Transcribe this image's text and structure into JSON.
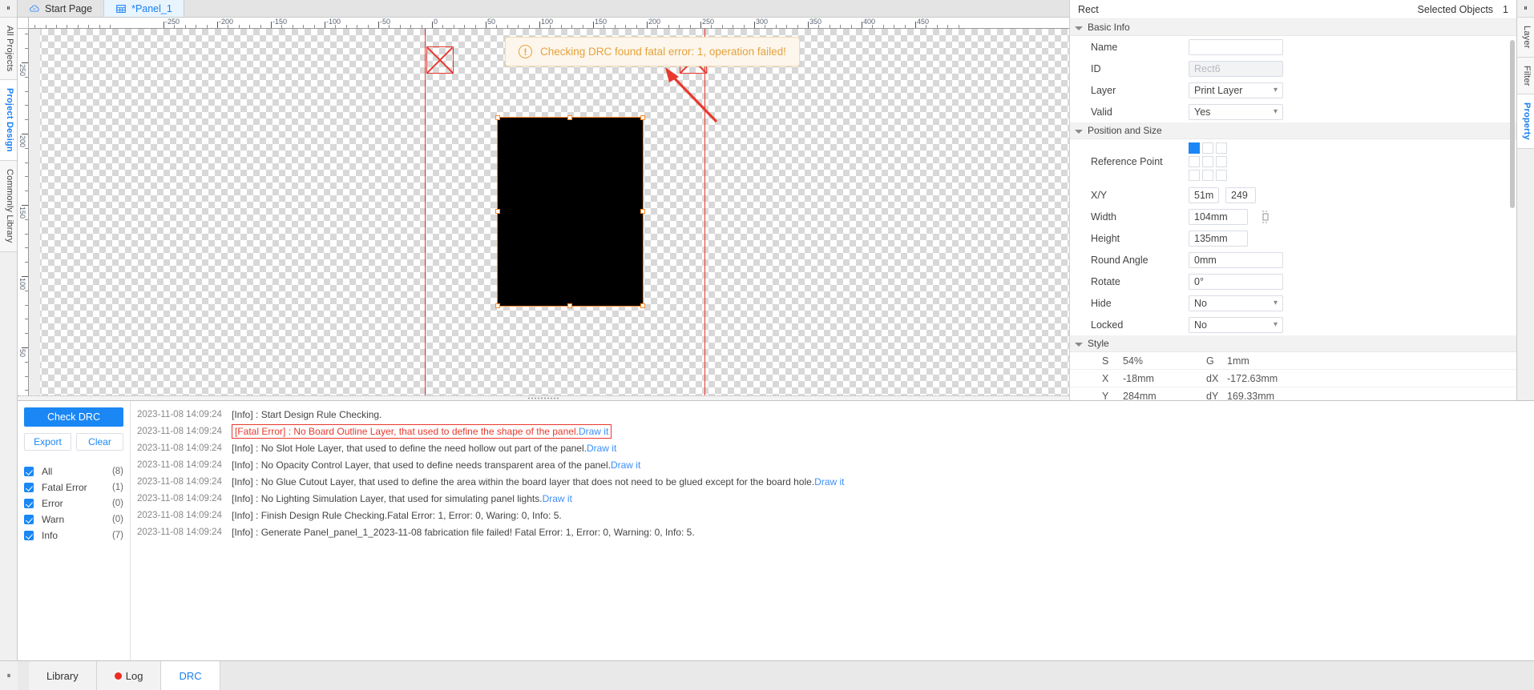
{
  "left_rail": {
    "pin_icon": "pin-icon",
    "tabs": [
      {
        "label": "All Projects",
        "active": false
      },
      {
        "label": "Project Design",
        "active": true
      },
      {
        "label": "Commonly Library",
        "active": false
      }
    ]
  },
  "right_rail": {
    "pin_icon": "pin-icon",
    "tabs": [
      {
        "label": "Layer",
        "active": false
      },
      {
        "label": "Filter",
        "active": false
      },
      {
        "label": "Property",
        "active": true
      }
    ]
  },
  "doc_tabs": [
    {
      "label": "Start Page",
      "icon": "cloud-icon",
      "active": false
    },
    {
      "label": "*Panel_1",
      "icon": "panel-grid-icon",
      "active": true
    }
  ],
  "canvas": {
    "h_ruler_labels": [
      "-250",
      "-200",
      "-150",
      "-100",
      "-50",
      "0",
      "50",
      "100",
      "150",
      "200",
      "250",
      "300",
      "350",
      "400",
      "450"
    ],
    "v_ruler_labels": [
      "250",
      "200",
      "150",
      "100",
      "50"
    ],
    "toast": {
      "icon": "warning-circle-icon",
      "message": "Checking DRC found fatal error: 1, operation failed!"
    }
  },
  "properties": {
    "header": {
      "object_type": "Rect",
      "selected_label": "Selected Objects",
      "selected_count": "1"
    },
    "basic_info": {
      "title": "Basic Info",
      "name_label": "Name",
      "name_value": "",
      "id_label": "ID",
      "id_value": "Rect6",
      "layer_label": "Layer",
      "layer_value": "Print Layer",
      "valid_label": "Valid",
      "valid_value": "Yes"
    },
    "position_size": {
      "title": "Position and Size",
      "reference_point_label": "Reference Point",
      "xy_label": "X/Y",
      "x_value": "51m",
      "y_value": "249",
      "width_label": "Width",
      "width_value": "104mm",
      "height_label": "Height",
      "height_value": "135mm",
      "round_angle_label": "Round Angle",
      "round_angle_value": "0mm",
      "rotate_label": "Rotate",
      "rotate_value": "0°",
      "hide_label": "Hide",
      "hide_value": "No",
      "locked_label": "Locked",
      "locked_value": "No",
      "lock_ratio_icon": "lock-aspect-ratio-icon"
    },
    "style": {
      "title": "Style",
      "rows": [
        {
          "k1": "S",
          "v1": "54%",
          "k2": "G",
          "v2": "1mm"
        },
        {
          "k1": "X",
          "v1": "-18mm",
          "k2": "dX",
          "v2": "-172.63mm"
        },
        {
          "k1": "Y",
          "v1": "284mm",
          "k2": "dY",
          "v2": "169.33mm"
        }
      ]
    }
  },
  "drc": {
    "check_button": "Check DRC",
    "export_button": "Export",
    "clear_button": "Clear",
    "filters": [
      {
        "label": "All",
        "count": "(8)",
        "checked": true
      },
      {
        "label": "Fatal Error",
        "count": "(1)",
        "checked": true
      },
      {
        "label": "Error",
        "count": "(0)",
        "checked": true
      },
      {
        "label": "Warn",
        "count": "(0)",
        "checked": true
      },
      {
        "label": "Info",
        "count": "(7)",
        "checked": true
      }
    ],
    "log": [
      {
        "time": "2023-11-08 14:09:24",
        "level": "[Info]",
        "message": " : Start Design Rule Checking.",
        "link": "",
        "severity": "info"
      },
      {
        "time": "2023-11-08 14:09:24",
        "level": "[Fatal Error]",
        "message": " : No Board Outline Layer, that used to define the shape of the panel.",
        "link": "Draw it",
        "severity": "fatal"
      },
      {
        "time": "2023-11-08 14:09:24",
        "level": "[Info]",
        "message": " : No Slot Hole Layer, that used to define the need hollow out part of the panel.",
        "link": "Draw it",
        "severity": "info"
      },
      {
        "time": "2023-11-08 14:09:24",
        "level": "[Info]",
        "message": " : No Opacity Control Layer, that used to define needs transparent area of the panel.",
        "link": "Draw it",
        "severity": "info"
      },
      {
        "time": "2023-11-08 14:09:24",
        "level": "[Info]",
        "message": " : No Glue Cutout Layer, that used to define the area within the board layer that does not need to be glued except for the board hole.",
        "link": "Draw it",
        "severity": "info"
      },
      {
        "time": "2023-11-08 14:09:24",
        "level": "[Info]",
        "message": " : No Lighting Simulation Layer, that used for simulating panel lights.",
        "link": "Draw it",
        "severity": "info"
      },
      {
        "time": "2023-11-08 14:09:24",
        "level": "[Info]",
        "message": " : Finish Design Rule Checking.Fatal Error: 1, Error: 0, Waring: 0, Info: 5.",
        "link": "",
        "severity": "info"
      },
      {
        "time": "2023-11-08 14:09:24",
        "level": "[Info]",
        "message": " : Generate Panel_panel_1_2023-11-08 fabrication file failed! Fatal Error: 1, Error: 0, Warning: 0, Info: 5.",
        "link": "",
        "severity": "info"
      }
    ]
  },
  "bottom_tabs": [
    {
      "label": "Library",
      "active": false,
      "icon": ""
    },
    {
      "label": "Log",
      "active": false,
      "icon": "red-dot-icon"
    },
    {
      "label": "DRC",
      "active": true,
      "icon": ""
    }
  ],
  "colors": {
    "accent": "#1a87f5",
    "error": "#e8392e",
    "warn": "#e6a23c",
    "selection": "#ff8c2b"
  }
}
